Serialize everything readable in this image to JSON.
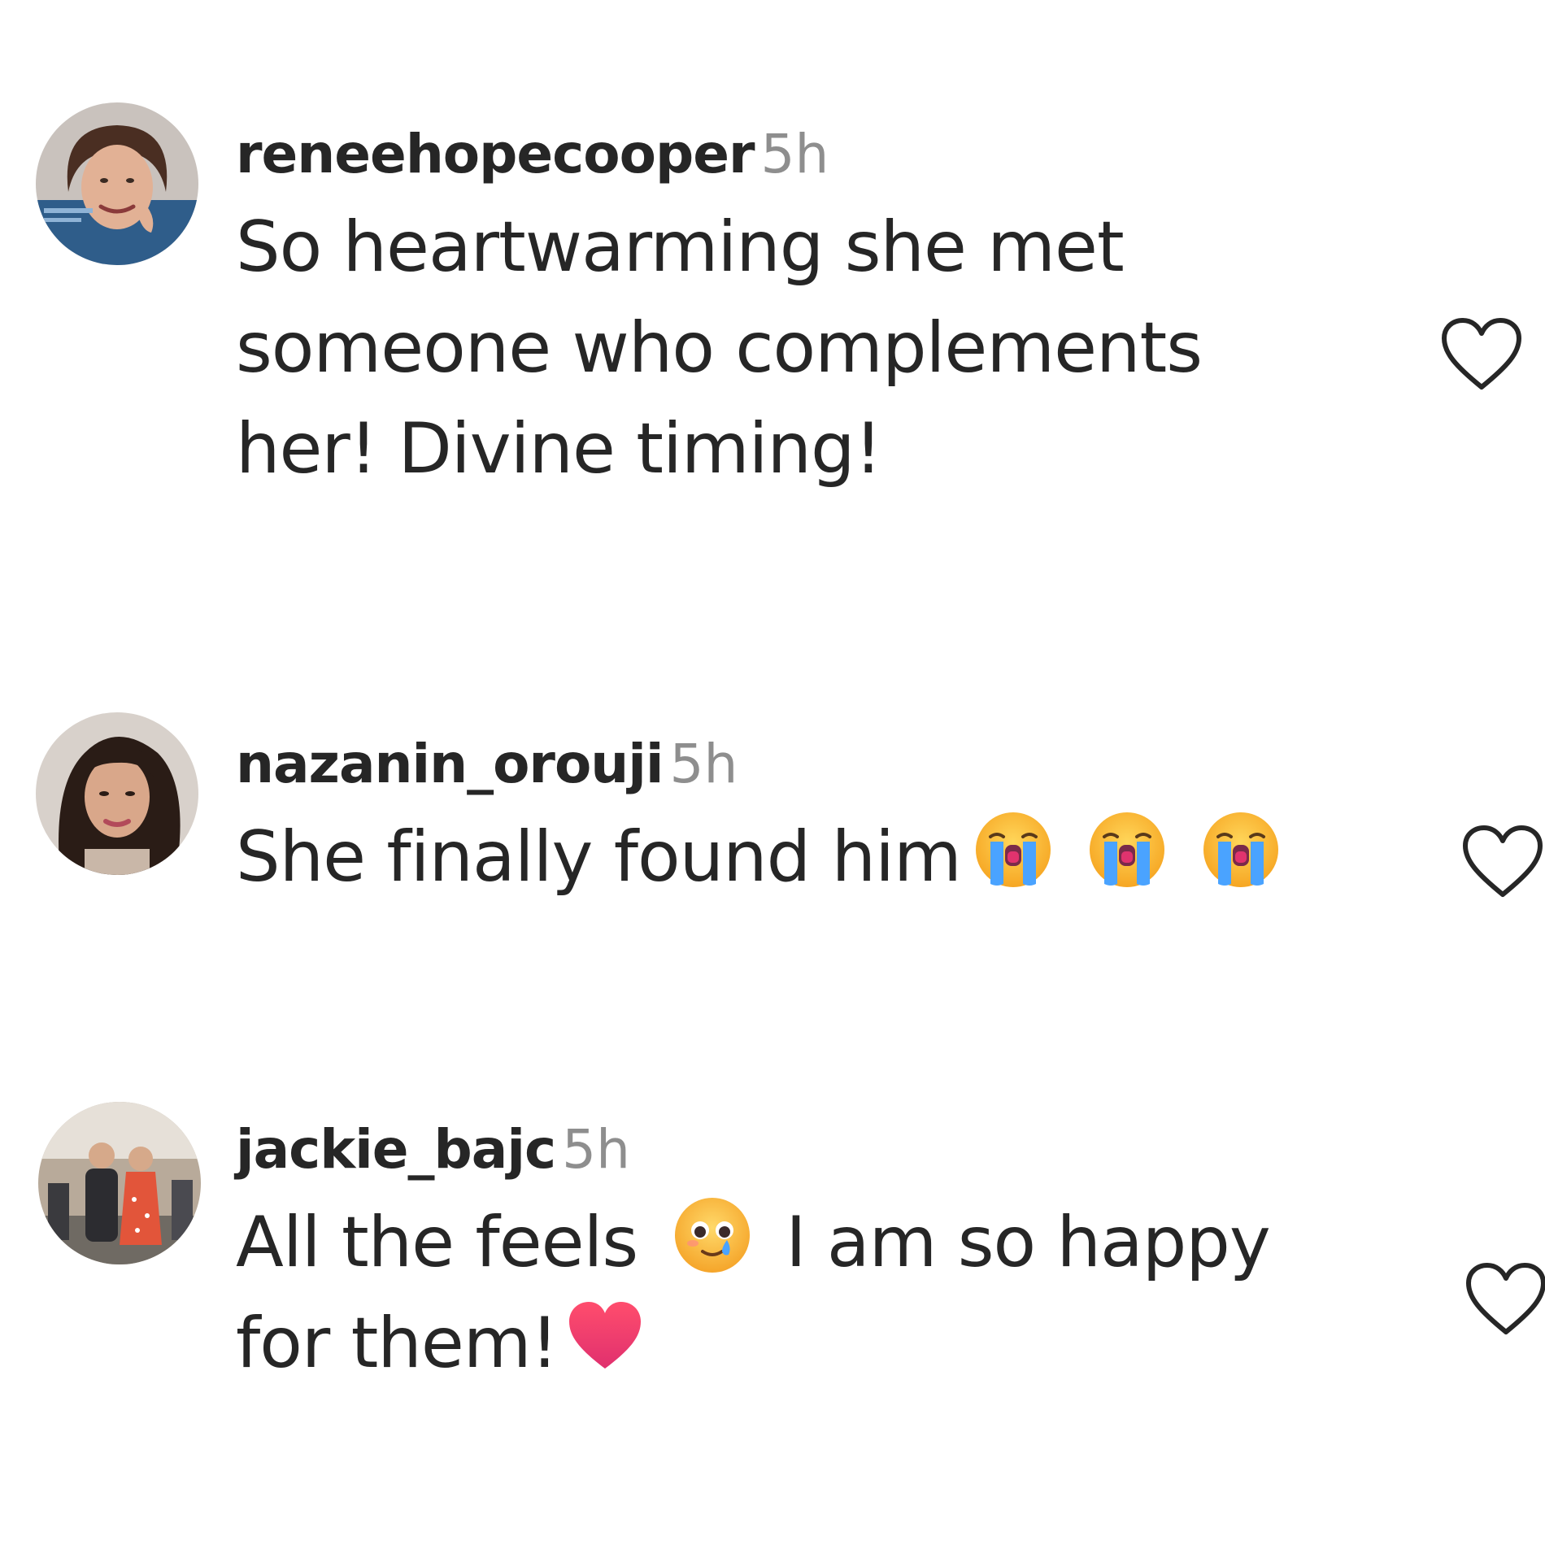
{
  "comments": [
    {
      "username": "reneehopecooper",
      "time": "5h",
      "lines": [
        "So heartwarming she met",
        "someone who complements",
        "her! Divine timing!"
      ],
      "avatar_icon": "avatar-woman-smiling",
      "like_icon": "heart-outline-icon"
    },
    {
      "username": "nazanin_orouji",
      "time": "5h",
      "text": "She finally found him",
      "emojis": [
        "loudly-crying-face",
        "loudly-crying-face",
        "loudly-crying-face"
      ],
      "avatar_icon": "avatar-woman-curly-hair",
      "like_icon": "heart-outline-icon"
    },
    {
      "username": "jackie_bajc",
      "time": "5h",
      "line1_a": "All the feels",
      "line1_emoji": "face-holding-back-tears",
      "line1_b": "I am so happy",
      "line2": "for them!",
      "line2_emoji": "red-heart",
      "avatar_icon": "avatar-couple-photo",
      "like_icon": "heart-outline-icon"
    }
  ],
  "colors": {
    "text": "#262626",
    "secondary": "#8e8e8e",
    "background": "#ffffff"
  }
}
